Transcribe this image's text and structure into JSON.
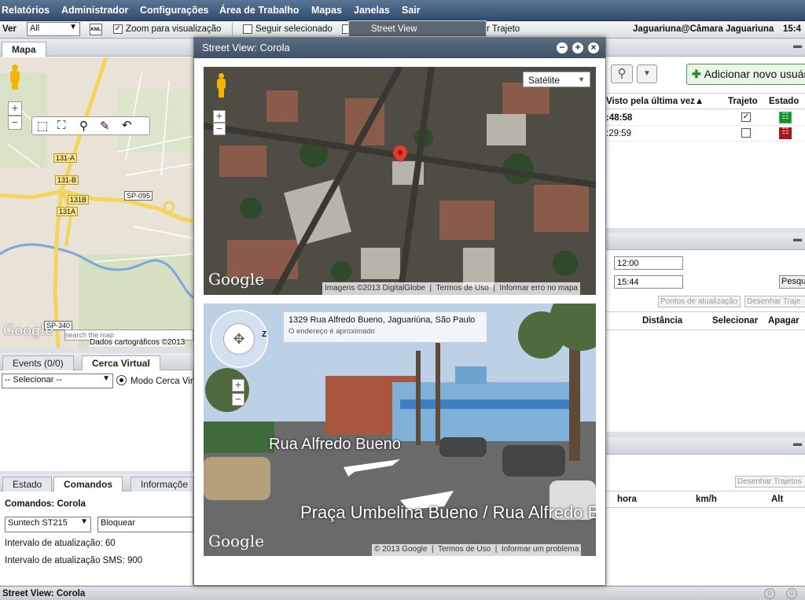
{
  "menu": {
    "items": [
      "Relatórios",
      "Administrador",
      "Configurações",
      "Área de Trabalho",
      "Mapas",
      "Janelas",
      "Sair"
    ]
  },
  "toolbar": {
    "ver_label": "Ver",
    "ver_value": "All",
    "kml_label": "KML",
    "zoom_label": "Zoom para visualização",
    "seguir_label": "Seguir selecionado",
    "trajeto_label": "r Trajeto",
    "user_label": "Jaguariuna@Câmara Jaguariuna",
    "clock": "15:4",
    "dropdown_item": "Street View"
  },
  "map_panel": {
    "tab": "Mapa",
    "road_labels": [
      "131-A",
      "131-B",
      "131B",
      "131A",
      "SP-095",
      "SP-340"
    ],
    "search_placeholder": "search the map",
    "attribution": "Dados cartográficos ©2013",
    "google": "Google"
  },
  "events_panel": {
    "tabs": [
      "Events (0/0)",
      "Cerca Virtual"
    ],
    "select_value": "-- Selecionar --",
    "mode_label": "Modo Cerca Vir"
  },
  "commands_panel": {
    "tabs": [
      "Estado",
      "Comandos",
      "Informaçõe"
    ],
    "title": "Comandos: Corola",
    "device_value": "Suntech ST215",
    "command_value": "Bloquear",
    "interval_line": "Intervalo de atualização: 60",
    "interval_sms_line": "Intervalo de atualização SMS: 900"
  },
  "status_bar": {
    "title": "Street View: Corola",
    "counts": [
      "0",
      "0"
    ]
  },
  "right_panel": {
    "add_user": "Adicionar novo usuário",
    "columns": [
      "Visto pela última vez▲",
      "Trajeto",
      "Estado"
    ],
    "rows": [
      {
        "time": ":48:58",
        "trajeto": true,
        "status_color": "#1e8a2e"
      },
      {
        "time": ":29:59",
        "trajeto": false,
        "status_color": "#a8161b"
      }
    ],
    "time_from": "12:00",
    "time_to": "15:44",
    "search_btn": "Pesqui",
    "btn_points": "Pontos de atualização",
    "btn_draw": "Desenhar Traje",
    "cols2": [
      "Distância",
      "Selecionar",
      "Apagar"
    ],
    "btn_draw2": "Desenhar Trajetos",
    "cols3": [
      "hora",
      "km/h",
      "Alt"
    ]
  },
  "street_window": {
    "title": "Street View: Corola",
    "map_type": "Satélite",
    "map_attr": [
      "Imagens ©2013 DigitalGlobe",
      "Termos de Uso",
      "Informar erro no mapa"
    ],
    "address": "1329 Rua Alfredo Bueno, Jaguariúna, São Paulo",
    "address_note": "O endereço é aproximado",
    "street1": "Rua Alfredo Bueno",
    "street2": "Praça Umbelina Bueno / Rua Alfredo Bu",
    "sv_attr": [
      "© 2013 Google",
      "Termos de Uso",
      "Informar um problema"
    ],
    "google": "Google",
    "compass_letter": "Z"
  }
}
